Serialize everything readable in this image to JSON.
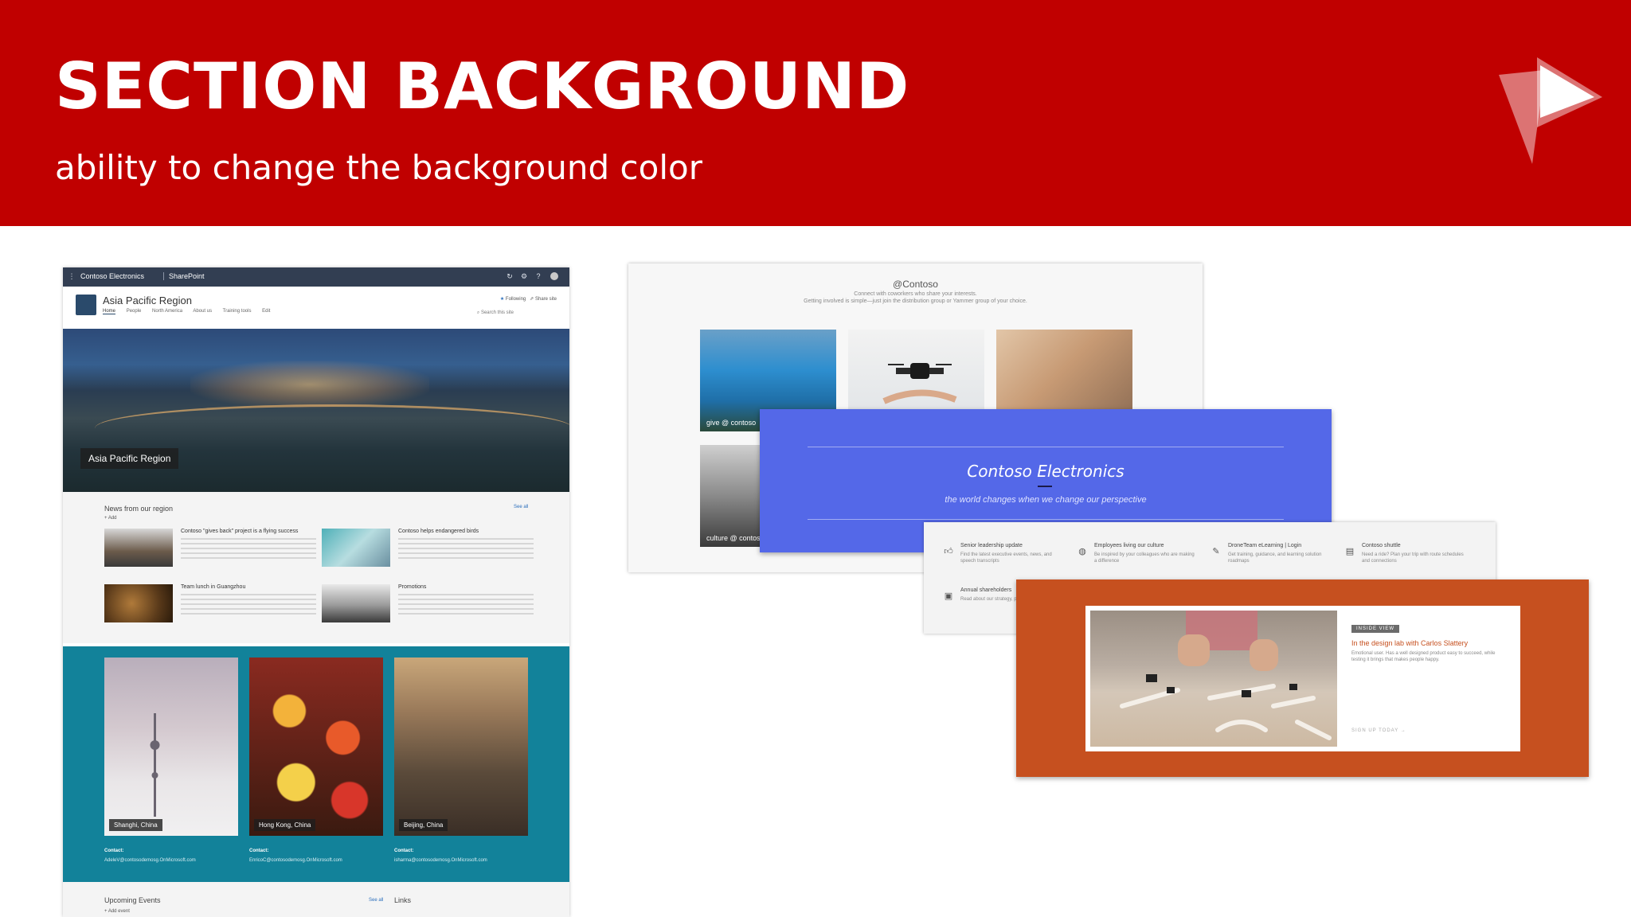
{
  "slide": {
    "title": "SECTION BACKGROUND",
    "subtitle": "ability to change the background color",
    "logo_icon": "play-triangle-logo-icon"
  },
  "left_site": {
    "suitebar": {
      "brand": "Contoso Electronics",
      "app": "SharePoint"
    },
    "site_name": "Asia Pacific Region",
    "nav": [
      "Home",
      "People",
      "North America",
      "About us",
      "Training tools",
      "Edit"
    ],
    "follow": "Following",
    "share": "Share site",
    "search_placeholder": "Search this site",
    "hero_label": "Asia Pacific Region",
    "news": {
      "heading": "News from our region",
      "see_all": "See all",
      "add": "+ Add",
      "items": [
        {
          "title": "Contoso \"gives back\" project is a flying success"
        },
        {
          "title": "Contoso helps endangered birds"
        },
        {
          "title": "Team lunch in Guangzhou"
        },
        {
          "title": "Promotions"
        }
      ]
    },
    "locations": [
      {
        "label": "Shanghi, China",
        "contact_label": "Contact:",
        "contact": "AdeleV@contosodemosg.OnMicrosoft.com"
      },
      {
        "label": "Hong Kong, China",
        "contact_label": "Contact:",
        "contact": "EnricoC@contosodemosg.OnMicrosoft.com"
      },
      {
        "label": "Beijing, China",
        "contact_label": "Contact:",
        "contact": "isharma@contosodemosg.OnMicrosoft.com"
      }
    ],
    "events": {
      "heading": "Upcoming Events",
      "see_all": "See all",
      "add": "+ Add event"
    },
    "links": {
      "heading": "Links"
    }
  },
  "panel_a": {
    "title": "@Contoso",
    "subtitle": "Connect with coworkers who share your interests.",
    "subtitle2": "Getting involved is simple—just join the distribution group or Yammer group of your choice.",
    "tiles": [
      {
        "label": "give @ contoso"
      },
      {
        "label": ""
      },
      {
        "label": ""
      },
      {
        "label": "culture @ contoso"
      }
    ]
  },
  "panel_b": {
    "title": "Contoso Electronics",
    "subtitle": "the world changes when we change our perspective"
  },
  "panel_c": {
    "links": [
      {
        "icon": "thumbs-up-icon",
        "title": "Senior leadership update",
        "desc": "Find the latest executive events, news, and speech transcripts"
      },
      {
        "icon": "globe-icon",
        "title": "Employees living our culture",
        "desc": "Be inspired by your colleagues who are making a difference"
      },
      {
        "icon": "pencil-icon",
        "title": "DroneTeam eLearning | Login",
        "desc": "Get training, guidance, and learning solution roadmaps"
      },
      {
        "icon": "bus-icon",
        "title": "Contoso shuttle",
        "desc": "Need a ride? Plan your trip with route schedules and connections"
      },
      {
        "icon": "report-icon",
        "title": "Annual shareholders",
        "desc": "Read about our strategy, products, and future"
      }
    ]
  },
  "panel_d": {
    "tag": "INSIDE VIEW",
    "title": "In the design lab with Carlos Slattery",
    "text": "Emotional user. Has a well designed product easy to succeed, while testing it brings that makes people happy.",
    "link": "SIGN UP TODAY →"
  },
  "colors": {
    "band": "#c00000",
    "teal_section": "#12829a",
    "blue_panel": "#5468e8",
    "orange_panel": "#c6501f"
  }
}
